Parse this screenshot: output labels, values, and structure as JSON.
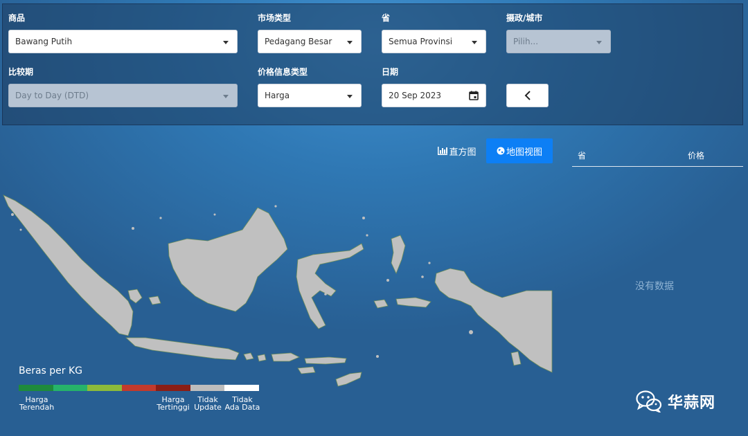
{
  "filters": {
    "commodity": {
      "label": "商品",
      "value": "Bawang Putih"
    },
    "market_type": {
      "label": "市场类型",
      "value": "Pedagang Besar"
    },
    "province": {
      "label": "省",
      "value": "Semua Provinsi"
    },
    "regency": {
      "label": "摄政/城市",
      "placeholder": "Pilih..."
    },
    "compare_period": {
      "label": "比较期",
      "value": "Day to Day (DTD)"
    },
    "price_info_type": {
      "label": "价格信息类型",
      "value": "Harga"
    },
    "date": {
      "label": "日期",
      "value": "20 Sep 2023"
    }
  },
  "view": {
    "histogram_label": "直方图",
    "map_label": "地图视图"
  },
  "table": {
    "col_province": "省",
    "col_price": "价格",
    "empty_text": "没有数据"
  },
  "legend": {
    "title": "Beras per KG",
    "items": [
      {
        "color": "#1e8a3c",
        "label_l1": "Harga",
        "label_l2": "Terendah"
      },
      {
        "color": "#26b36a",
        "label_l1": "",
        "label_l2": ""
      },
      {
        "color": "#8cba3a",
        "label_l1": "",
        "label_l2": ""
      },
      {
        "color": "#c23a2c",
        "label_l1": "",
        "label_l2": ""
      },
      {
        "color": "#8a1e16",
        "label_l1": "Harga",
        "label_l2": "Tertinggi"
      },
      {
        "color": "#bdbdbd",
        "label_l1": "Tidak",
        "label_l2": "Update"
      },
      {
        "color": "#ffffff",
        "label_l1": "Tidak",
        "label_l2": "Ada Data"
      }
    ]
  },
  "watermark": {
    "text": "华蒜网",
    "icon": "wechat-icon"
  },
  "colors": {
    "map_land": "#c0c0c0",
    "map_border": "#6f8f5a",
    "accent": "#0d7ff5"
  }
}
